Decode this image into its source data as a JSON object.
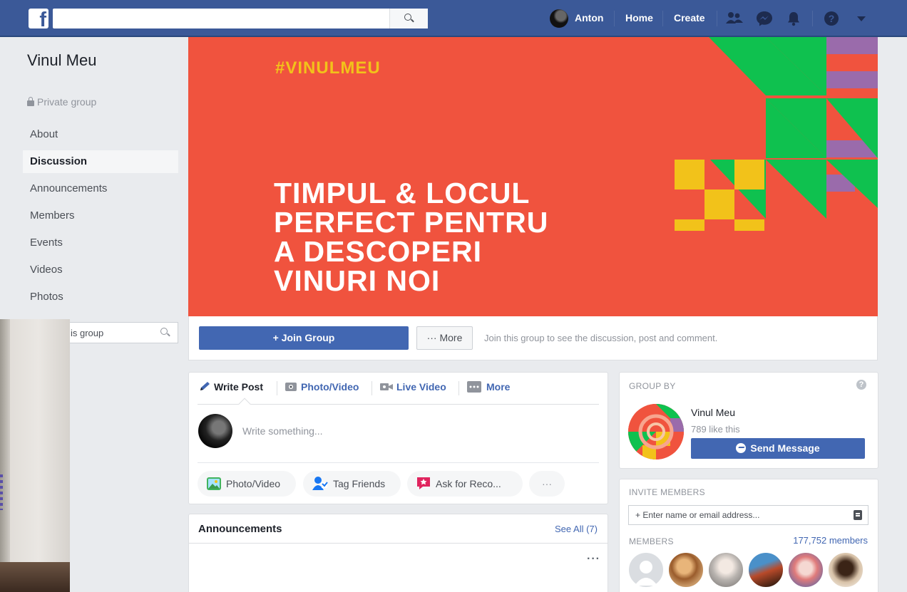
{
  "topbar": {
    "logo_letter": "f",
    "search_placeholder": "",
    "user_name": "Anton",
    "home_label": "Home",
    "create_label": "Create"
  },
  "sidebar": {
    "group_name": "Vinul Meu",
    "privacy": "Private group",
    "items": [
      {
        "label": "About",
        "active": false
      },
      {
        "label": "Discussion",
        "active": true
      },
      {
        "label": "Announcements",
        "active": false
      },
      {
        "label": "Members",
        "active": false
      },
      {
        "label": "Events",
        "active": false
      },
      {
        "label": "Videos",
        "active": false
      },
      {
        "label": "Photos",
        "active": false
      }
    ],
    "search_text": "is group"
  },
  "cover": {
    "hashtag": "#VINULMEU",
    "headline": [
      "TIMPUL & LOCUL",
      "PERFECT PENTRU",
      "A DESCOPERI",
      "VINURI NOI"
    ]
  },
  "actions": {
    "join_label": "+ Join Group",
    "more_label": "··· More",
    "note": "Join this group to see the discussion, post and comment."
  },
  "composer": {
    "tabs": [
      "Write Post",
      "Photo/Video",
      "Live Video",
      "More"
    ],
    "placeholder": "Write something...",
    "pills": [
      "Photo/Video",
      "Tag Friends",
      "Ask for Reco...",
      "···"
    ]
  },
  "announcements": {
    "title": "Announcements",
    "see_all": "See All (7)",
    "menu": "···"
  },
  "group_by": {
    "heading": "GROUP BY",
    "name": "Vinul Meu",
    "likes": "789 like this",
    "send_label": "Send Message"
  },
  "invite": {
    "heading": "INVITE MEMBERS",
    "input_placeholder": "+ Enter name or email address...",
    "members_heading": "MEMBERS",
    "members_count": "177,752 members"
  },
  "colors": {
    "facebook_blue": "#3b5998",
    "button_blue": "#4267b2",
    "cover_red": "#f0533e",
    "cover_yellow": "#f2c21a",
    "cover_green": "#0fc14f",
    "cover_purple": "#9a6bab"
  }
}
